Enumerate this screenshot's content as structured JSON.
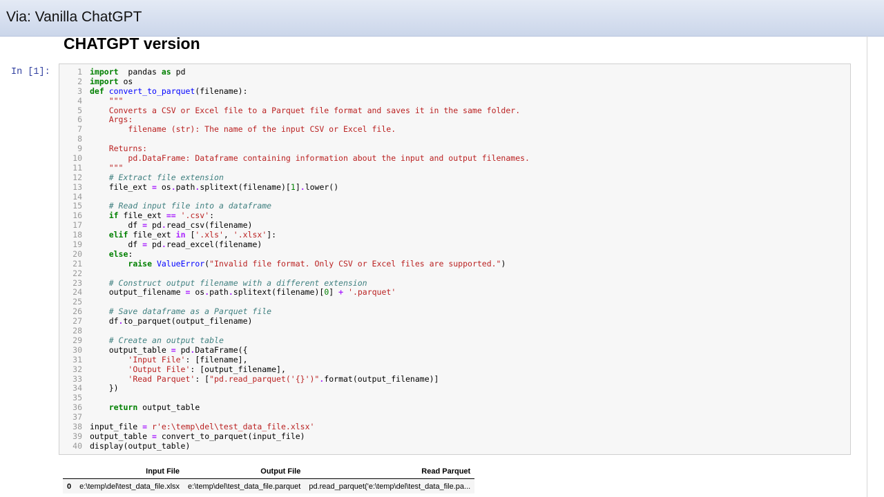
{
  "banner": {
    "text": "Via: Vanilla ChatGPT"
  },
  "notebook": {
    "heading": "CHATGPT version",
    "prompt": "In [1]:",
    "code": [
      [
        [
          "kw",
          "import"
        ],
        [
          "",
          "  pandas "
        ],
        [
          "kw",
          "as"
        ],
        [
          "",
          " pd"
        ]
      ],
      [
        [
          "kw",
          "import"
        ],
        [
          "",
          " os"
        ]
      ],
      [
        [
          "kw",
          "def"
        ],
        [
          "",
          " "
        ],
        [
          "fn",
          "convert_to_parquet"
        ],
        [
          "",
          "(filename):"
        ]
      ],
      [
        [
          "",
          "    "
        ],
        [
          "st",
          "\"\"\""
        ]
      ],
      [
        [
          "",
          "    "
        ],
        [
          "st",
          "Converts a CSV or Excel file to a Parquet file format and saves it in the same folder."
        ]
      ],
      [
        [
          "",
          "    "
        ],
        [
          "st",
          "Args:"
        ]
      ],
      [
        [
          "",
          "        "
        ],
        [
          "st",
          "filename (str): The name of the input CSV or Excel file."
        ]
      ],
      [],
      [
        [
          "",
          "    "
        ],
        [
          "st",
          "Returns:"
        ]
      ],
      [
        [
          "",
          "        "
        ],
        [
          "st",
          "pd.DataFrame: Dataframe containing information about the input and output filenames."
        ]
      ],
      [
        [
          "",
          "    "
        ],
        [
          "st",
          "\"\"\""
        ]
      ],
      [
        [
          "",
          "    "
        ],
        [
          "cm",
          "# Extract file extension"
        ]
      ],
      [
        [
          "",
          "    file_ext "
        ],
        [
          "op",
          "="
        ],
        [
          "",
          " os"
        ],
        [
          "op",
          "."
        ],
        [
          "",
          "path"
        ],
        [
          "op",
          "."
        ],
        [
          "",
          "splitext(filename)["
        ],
        [
          "nu",
          "1"
        ],
        [
          "",
          "]"
        ],
        [
          "op",
          "."
        ],
        [
          "",
          "lower()"
        ]
      ],
      [],
      [
        [
          "",
          "    "
        ],
        [
          "cm",
          "# Read input file into a dataframe"
        ]
      ],
      [
        [
          "",
          "    "
        ],
        [
          "kw",
          "if"
        ],
        [
          "",
          " file_ext "
        ],
        [
          "op",
          "=="
        ],
        [
          "",
          " "
        ],
        [
          "st",
          "'.csv'"
        ],
        [
          "",
          ":"
        ]
      ],
      [
        [
          "",
          "        df "
        ],
        [
          "op",
          "="
        ],
        [
          "",
          " pd"
        ],
        [
          "op",
          "."
        ],
        [
          "",
          "read_csv(filename)"
        ]
      ],
      [
        [
          "",
          "    "
        ],
        [
          "kw",
          "elif"
        ],
        [
          "",
          " file_ext "
        ],
        [
          "op",
          "in"
        ],
        [
          "",
          " ["
        ],
        [
          "st",
          "'.xls'"
        ],
        [
          "",
          ", "
        ],
        [
          "st",
          "'.xlsx'"
        ],
        [
          "",
          "]:"
        ]
      ],
      [
        [
          "",
          "        df "
        ],
        [
          "op",
          "="
        ],
        [
          "",
          " pd"
        ],
        [
          "op",
          "."
        ],
        [
          "",
          "read_excel(filename)"
        ]
      ],
      [
        [
          "",
          "    "
        ],
        [
          "kw",
          "else"
        ],
        [
          "",
          ":"
        ]
      ],
      [
        [
          "",
          "        "
        ],
        [
          "kw",
          "raise"
        ],
        [
          "",
          " "
        ],
        [
          "fn",
          "ValueError"
        ],
        [
          "",
          "("
        ],
        [
          "st",
          "\"Invalid file format. Only CSV or Excel files are supported.\""
        ],
        [
          "",
          ")"
        ]
      ],
      [],
      [
        [
          "",
          "    "
        ],
        [
          "cm",
          "# Construct output filename with a different extension"
        ]
      ],
      [
        [
          "",
          "    output_filename "
        ],
        [
          "op",
          "="
        ],
        [
          "",
          " os"
        ],
        [
          "op",
          "."
        ],
        [
          "",
          "path"
        ],
        [
          "op",
          "."
        ],
        [
          "",
          "splitext(filename)["
        ],
        [
          "nu",
          "0"
        ],
        [
          "",
          "] "
        ],
        [
          "op",
          "+"
        ],
        [
          "",
          " "
        ],
        [
          "st",
          "'.parquet'"
        ]
      ],
      [],
      [
        [
          "",
          "    "
        ],
        [
          "cm",
          "# Save dataframe as a Parquet file"
        ]
      ],
      [
        [
          "",
          "    df"
        ],
        [
          "op",
          "."
        ],
        [
          "",
          "to_parquet(output_filename)"
        ]
      ],
      [],
      [
        [
          "",
          "    "
        ],
        [
          "cm",
          "# Create an output table"
        ]
      ],
      [
        [
          "",
          "    output_table "
        ],
        [
          "op",
          "="
        ],
        [
          "",
          " pd"
        ],
        [
          "op",
          "."
        ],
        [
          "",
          "DataFrame({"
        ]
      ],
      [
        [
          "",
          "        "
        ],
        [
          "st",
          "'Input File'"
        ],
        [
          "",
          ": [filename],"
        ]
      ],
      [
        [
          "",
          "        "
        ],
        [
          "st",
          "'Output File'"
        ],
        [
          "",
          ": [output_filename],"
        ]
      ],
      [
        [
          "",
          "        "
        ],
        [
          "st",
          "'Read Parquet'"
        ],
        [
          "",
          ": ["
        ],
        [
          "st",
          "\"pd.read_parquet('{}')\""
        ],
        [
          "op",
          "."
        ],
        [
          "",
          "format(output_filename)]"
        ]
      ],
      [
        [
          "",
          "    })"
        ]
      ],
      [],
      [
        [
          "",
          "    "
        ],
        [
          "kw",
          "return"
        ],
        [
          "",
          " output_table"
        ]
      ],
      [],
      [
        [
          "",
          "input_file "
        ],
        [
          "op",
          "="
        ],
        [
          "",
          " "
        ],
        [
          "st",
          "r'e:\\temp\\del\\test_data_file.xlsx'"
        ]
      ],
      [
        [
          "",
          "output_table "
        ],
        [
          "op",
          "="
        ],
        [
          "",
          " convert_to_parquet(input_file)"
        ]
      ],
      [
        [
          "",
          "display(output_table)"
        ]
      ]
    ]
  },
  "output_table": {
    "headers": [
      "",
      "Input File",
      "Output File",
      "Read Parquet"
    ],
    "rows": [
      [
        "0",
        "e:\\temp\\del\\test_data_file.xlsx",
        "e:\\temp\\del\\test_data_file.parquet",
        "pd.read_parquet('e:\\temp\\del\\test_data_file.pa..."
      ]
    ]
  }
}
